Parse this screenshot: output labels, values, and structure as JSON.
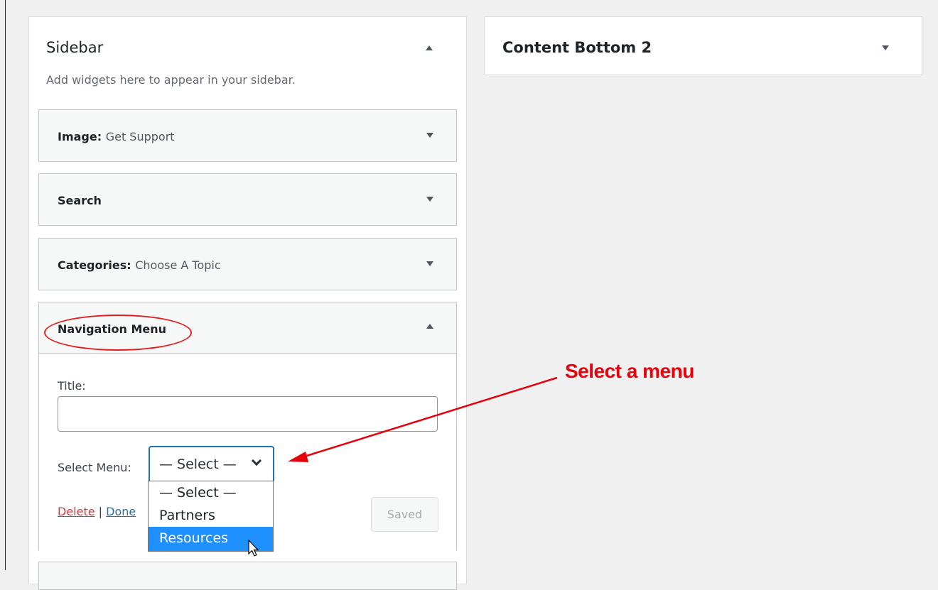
{
  "sidebar_area": {
    "title": "Sidebar",
    "description": "Add widgets here to appear in your sidebar."
  },
  "content_area": {
    "title": "Content Bottom 2"
  },
  "widgets": [
    {
      "title": "Image:",
      "subtitle": "Get Support"
    },
    {
      "title": "Search",
      "subtitle": ""
    },
    {
      "title": "Categories:",
      "subtitle": "Choose A Topic"
    },
    {
      "title": "Navigation Menu",
      "subtitle": ""
    }
  ],
  "nav_menu_form": {
    "title_label": "Title:",
    "title_value": "",
    "select_label": "Select Menu:",
    "select_value": "— Select —",
    "options": [
      "— Select —",
      "Partners",
      "Resources"
    ],
    "highlighted_option": "Resources",
    "delete_label": "Delete",
    "separator": "|",
    "done_label": "Done",
    "saved_label": "Saved"
  },
  "annotation": {
    "text": "Select a menu",
    "color": "#e8000b"
  },
  "colors": {
    "accent": "#2271b1",
    "danger": "#d63638",
    "highlight": "#1e90ff"
  }
}
